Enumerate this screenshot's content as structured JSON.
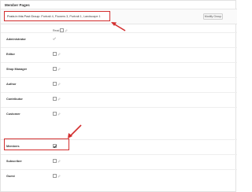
{
  "panel": {
    "title": "Member Pages"
  },
  "group": {
    "label": "Posts in this Post Group:",
    "value": "Portrait 4, Flowers 3, Portrait 1, Landscape 1",
    "modify_label": "Modify Group"
  },
  "columns": {
    "read": "Read"
  },
  "roles": [
    {
      "name": "Administrator",
      "checked": true,
      "locked": true
    },
    {
      "name": "Editor",
      "checked": false
    },
    {
      "name": "Shop Manager",
      "checked": false
    },
    {
      "name": "Author",
      "checked": false
    },
    {
      "name": "Contributor",
      "checked": false
    },
    {
      "name": "Customer",
      "checked": false
    },
    {
      "name": "Members",
      "checked": true
    },
    {
      "name": "Subscriber",
      "checked": false
    },
    {
      "name": "Guest",
      "checked": false
    }
  ],
  "colors": {
    "highlight": "#d32f2f",
    "border": "#e2e2e2",
    "text": "#333333"
  },
  "icons": {
    "edit": "pencil-icon",
    "arrow": "red-arrow-annotation"
  }
}
